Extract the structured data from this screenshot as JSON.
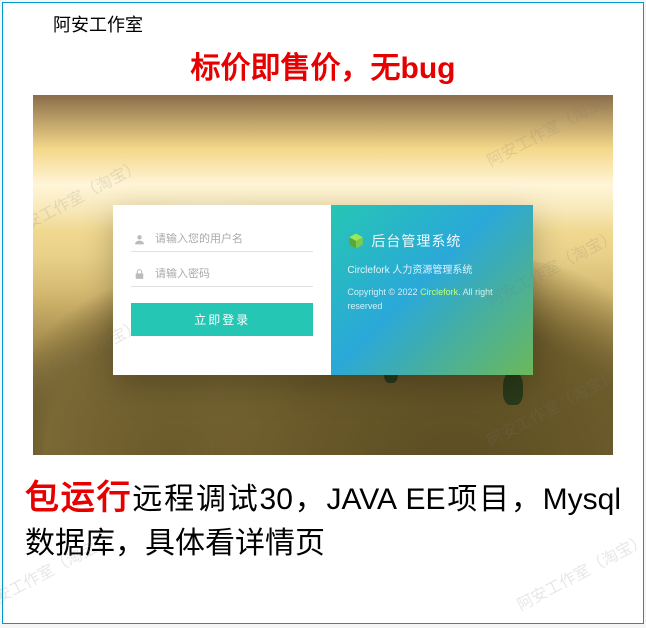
{
  "studio_label": "阿安工作室",
  "headline_top": "标价即售价，无bug",
  "login": {
    "username_placeholder": "请输入您的用户名",
    "password_placeholder": "请输入密码",
    "button_label": "立即登录",
    "brand_title": "后台管理系统",
    "brand_sub": "Circlefork 人力资源管理系统",
    "copyright_prefix": "Copyright © 2022 ",
    "copyright_highlight": "Circlefork",
    "copyright_suffix": ". All right reserved"
  },
  "headline_bottom": {
    "red": "包运行",
    "rest": "远程调试30，JAVA EE项目，Mysql数据库，具体看详情页"
  },
  "watermark_text": "阿安工作室（淘宝）"
}
